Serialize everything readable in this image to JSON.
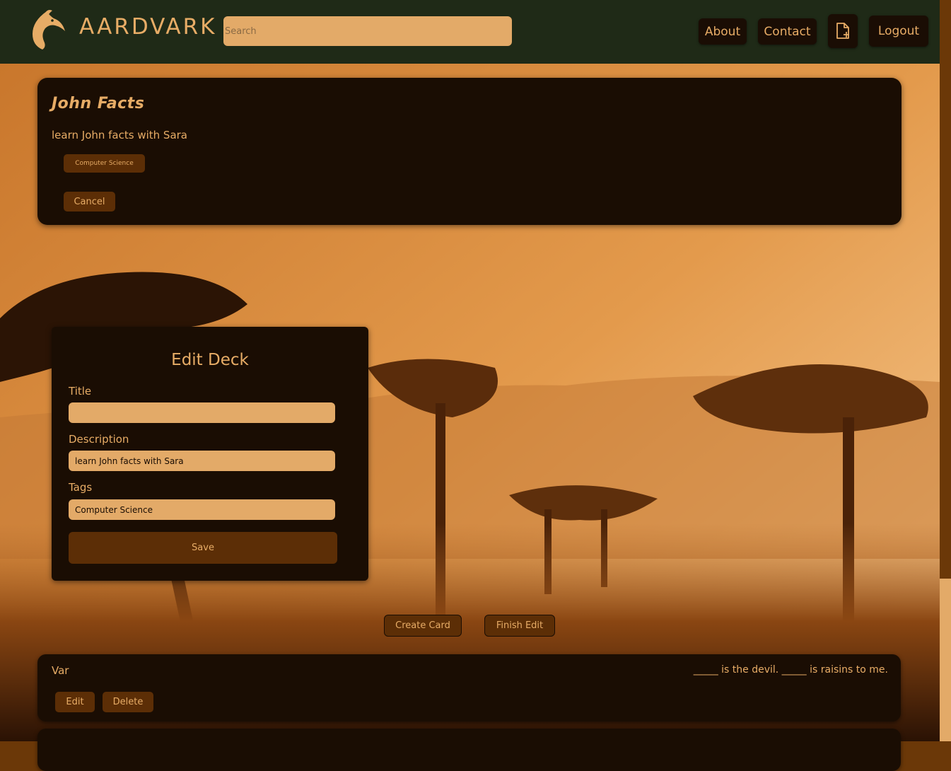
{
  "header": {
    "brand": "AARDVARK",
    "search_placeholder": "Search",
    "nav": {
      "about": "About",
      "contact": "Contact",
      "logout": "Logout"
    }
  },
  "deck": {
    "title": "John Facts",
    "description": "learn John facts with Sara",
    "tag": "Computer Science",
    "cancel_label": "Cancel"
  },
  "edit_form": {
    "heading": "Edit Deck",
    "title_label": "Title",
    "title_value": "",
    "description_label": "Description",
    "description_value": "learn John facts with Sara",
    "tags_label": "Tags",
    "tags_value": "Computer Science",
    "save_label": "Save"
  },
  "actions": {
    "create_card": "Create Card",
    "finish_edit": "Finish Edit"
  },
  "cards": [
    {
      "front": "Var",
      "back": "_____ is the devil. _____ is raisins to me.",
      "edit_label": "Edit",
      "delete_label": "Delete"
    }
  ],
  "colors": {
    "accent": "#e7ac66",
    "panel": "#1a0d03",
    "button": "#5c2e06",
    "navbar": "#1f2a17"
  }
}
